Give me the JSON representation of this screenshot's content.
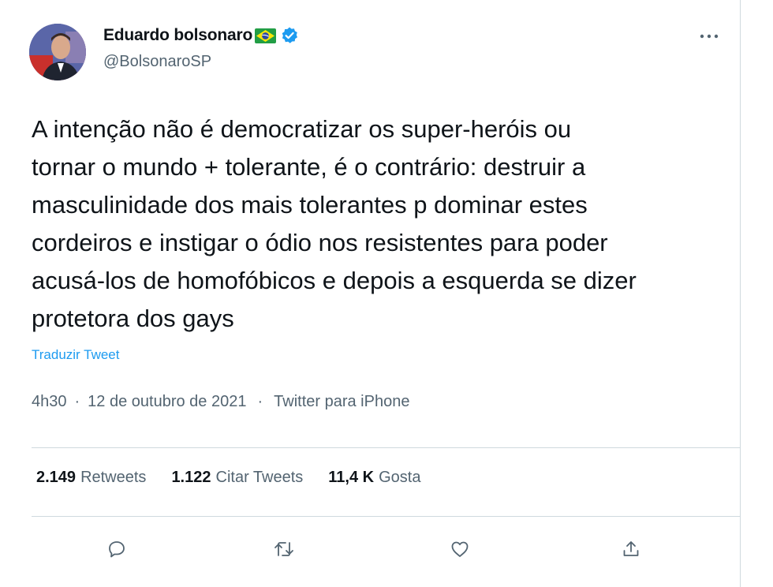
{
  "author": {
    "name": "Eduardo bolsonaro",
    "handle": "@BolsonaroSP",
    "flag_icon": "brazil-flag-icon",
    "verified_icon": "verified-badge-icon"
  },
  "tweet": {
    "text": "A intenção não é democratizar os super-heróis ou\ntornar o mundo + tolerante, é o contrário: destruir a\nmasculinidade dos mais tolerantes p dominar estes\ncordeiros e instigar o ódio nos resistentes para poder\nacusá-los de homofóbicos e depois a esquerda se dizer\nprotetora dos gays",
    "translate_label": "Traduzir Tweet",
    "time": "4h30",
    "date": "12 de outubro de 2021",
    "source": "Twitter para iPhone"
  },
  "stats": {
    "retweets_count": "2.149",
    "retweets_label": "Retweets",
    "quotes_count": "1.122",
    "quotes_label": "Citar Tweets",
    "likes_count": "11,4 K",
    "likes_label": "Gosta"
  },
  "actions": [
    "reply-icon",
    "retweet-icon",
    "like-icon",
    "share-icon"
  ],
  "colors": {
    "accent": "#1d9bf0",
    "text_primary": "#0f1419",
    "text_secondary": "#536471",
    "divider": "#cfd9de"
  }
}
